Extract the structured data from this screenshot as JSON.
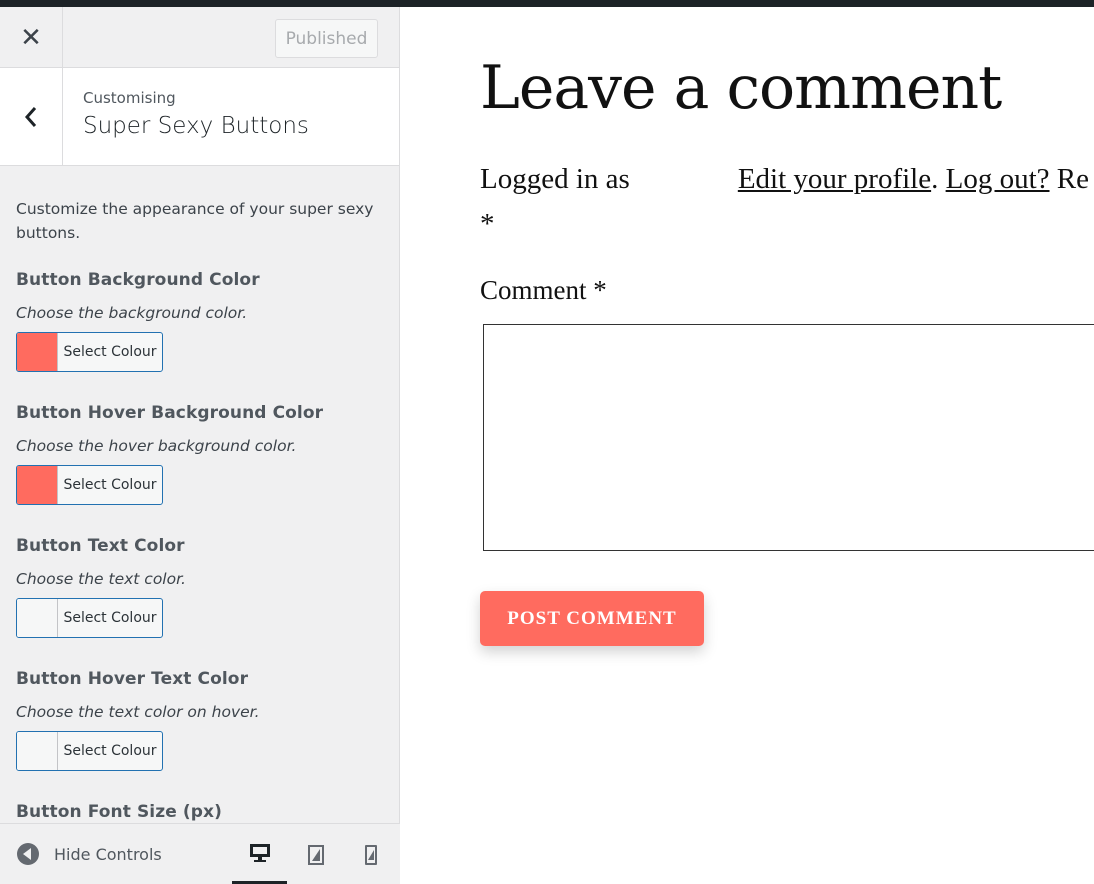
{
  "header": {
    "close_icon": "close-icon",
    "publish_label": "Published"
  },
  "section": {
    "back_icon": "chevron-left-icon",
    "breadcrumb": "Customising",
    "title": "Super Sexy Buttons",
    "description": "Customize the appearance of your super sexy buttons."
  },
  "controls": [
    {
      "title": "Button Background Color",
      "description": "Choose the background color.",
      "button_label": "Select Colour",
      "swatch_color": "#ff6b5f"
    },
    {
      "title": "Button Hover Background Color",
      "description": "Choose the hover background color.",
      "button_label": "Select Colour",
      "swatch_color": "#ff6b5f"
    },
    {
      "title": "Button Text Color",
      "description": "Choose the text color.",
      "button_label": "Select Colour",
      "swatch_color": "#f6f7f7"
    },
    {
      "title": "Button Hover Text Color",
      "description": "Choose the text color on hover.",
      "button_label": "Select Colour",
      "swatch_color": "#f6f7f7"
    },
    {
      "title": "Button Font Size (px)"
    }
  ],
  "footer": {
    "hide_label": "Hide Controls",
    "devices": [
      "desktop-icon",
      "tablet-icon",
      "mobile-icon"
    ],
    "active_device": "desktop"
  },
  "preview": {
    "title": "Leave a comment",
    "logged_in_prefix": "Logged in as",
    "edit_profile": "Edit your profile",
    "separator": ".",
    "log_out": "Log out?",
    "trailing": "Re",
    "required_star": "*",
    "comment_label": "Comment *",
    "post_button": "POST COMMENT"
  },
  "colors": {
    "accent": "#ff6b5f",
    "admin_blue": "#2271b1",
    "panel_bg": "#f0f0f1"
  }
}
